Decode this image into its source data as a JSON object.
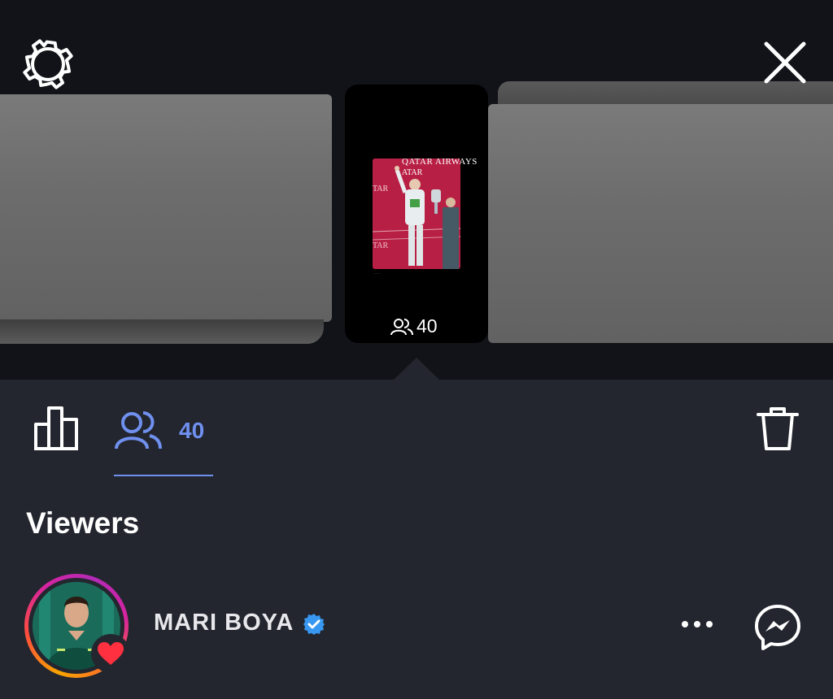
{
  "header": {
    "settings_icon": "gear-icon",
    "close_icon": "close-icon"
  },
  "story_card": {
    "viewer_count": "40",
    "image_text": "QATAR AIRWAYS",
    "people_icon": "people-icon"
  },
  "tabs": {
    "stats_icon": "bar-chart-icon",
    "viewers_icon": "people-icon",
    "viewers_count": "40",
    "delete_icon": "trash-icon"
  },
  "section": {
    "title": "Viewers"
  },
  "viewers": [
    {
      "name": "MARI BOYA",
      "verified": true,
      "reaction": "heart",
      "actions": [
        "more-icon",
        "messenger-icon"
      ]
    }
  ],
  "colors": {
    "accent_blue": "#7090f0",
    "verified_blue": "#3897f0",
    "heart_red": "#ff3040",
    "background": "#23262e",
    "top_background": "#111318"
  }
}
